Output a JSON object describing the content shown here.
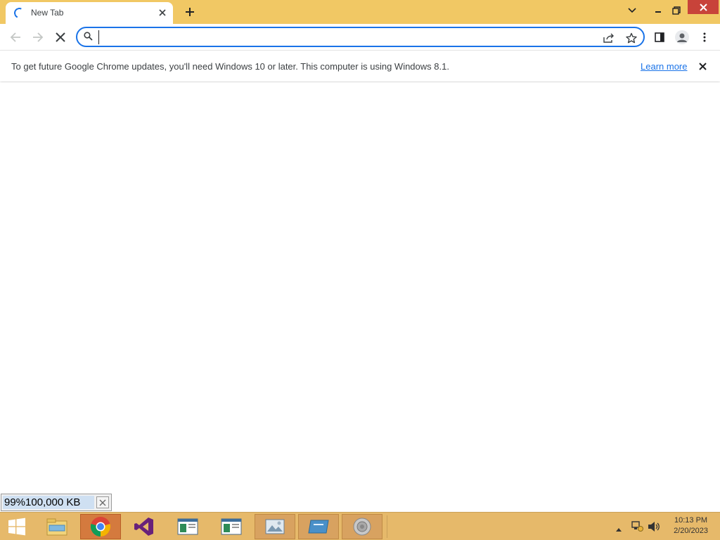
{
  "browser": {
    "tab": {
      "title": "New Tab",
      "close_icon": "close-icon"
    },
    "new_tab_icon": "plus-icon",
    "window_controls": [
      "chevron-down-icon",
      "minimize-icon",
      "restore-icon",
      "close-icon"
    ]
  },
  "toolbar": {
    "back_icon": "arrow-left-icon",
    "forward_icon": "arrow-right-icon",
    "stop_icon": "close-icon",
    "omnibox": {
      "value": "",
      "placeholder": ""
    },
    "right_icons": [
      "share-icon",
      "star-icon",
      "side-panel-icon",
      "profile-icon",
      "menu-icon"
    ]
  },
  "infobar": {
    "message": "To get future Google Chrome updates, you'll need Windows 10 or later. This computer is using Windows 8.1.",
    "link": "Learn more"
  },
  "download": {
    "text": "99%100,000 KB"
  },
  "taskbar": {
    "items": [
      "windows-start-icon",
      "file-explorer-icon",
      "chrome-icon",
      "visual-studio-icon",
      "app-window-icon",
      "app-window-icon",
      "photo-viewer-icon",
      "card-app-icon",
      "speaker-app-icon"
    ],
    "clock": {
      "time": "10:13 PM",
      "date": "2/20/2023"
    }
  },
  "colors": {
    "tabstrip": "#f1c864",
    "taskbar": "#e6b96a",
    "accent": "#1a73e8"
  }
}
